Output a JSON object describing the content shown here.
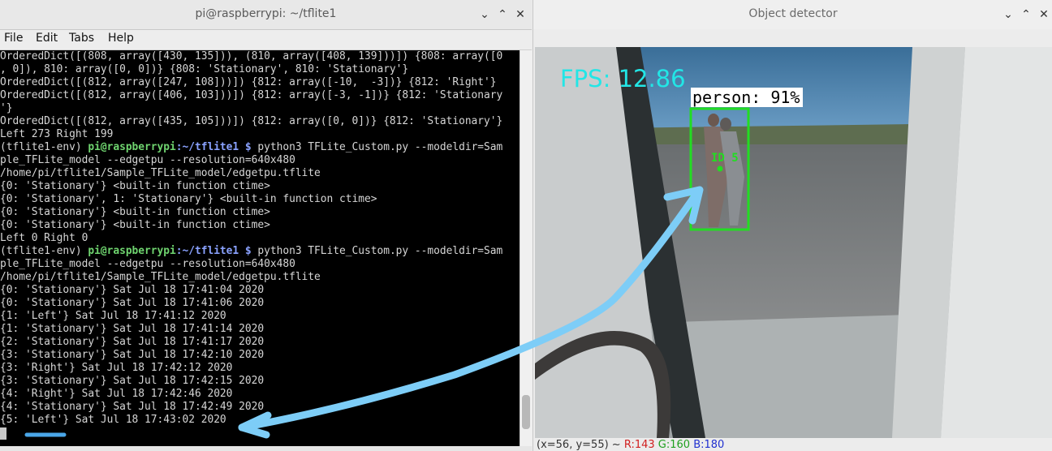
{
  "terminal": {
    "title": "pi@raspberrypi: ~/tflite1",
    "menu": [
      "File",
      "Edit",
      "Tabs",
      "Help"
    ],
    "lines": [
      {
        "text": "OrderedDict([(808, array([430, 135])), (810, array([408, 139]))]) {808: array([0"
      },
      {
        "text": ", 0]), 810: array([0, 0])} {808: 'Stationary', 810: 'Stationary'}"
      },
      {
        "text": "OrderedDict([(812, array([247, 108]))]) {812: array([-10,  -3])} {812: 'Right'}"
      },
      {
        "text": "OrderedDict([(812, array([406, 103]))]) {812: array([-3, -1])} {812: 'Stationary"
      },
      {
        "text": "'}"
      },
      {
        "text": "OrderedDict([(812, array([435, 105]))]) {812: array([0, 0])} {812: 'Stationary'}"
      },
      {
        "text": "Left 273 Right 199"
      },
      {
        "env": "(tflite1-env) ",
        "user": "pi@raspberrypi",
        "path": ":~/tflite1 $",
        "cmd": " python3 TFLite_Custom.py --modeldir=Sam"
      },
      {
        "text": "ple_TFLite_model --edgetpu --resolution=640x480"
      },
      {
        "text": "/home/pi/tflite1/Sample_TFLite_model/edgetpu.tflite"
      },
      {
        "text": "{0: 'Stationary'} <built-in function ctime>"
      },
      {
        "text": "{0: 'Stationary', 1: 'Stationary'} <built-in function ctime>"
      },
      {
        "text": "{0: 'Stationary'} <built-in function ctime>"
      },
      {
        "text": "{0: 'Stationary'} <built-in function ctime>"
      },
      {
        "text": "Left 0 Right 0"
      },
      {
        "env": "(tflite1-env) ",
        "user": "pi@raspberrypi",
        "path": ":~/tflite1 $",
        "cmd": " python3 TFLite_Custom.py --modeldir=Sam"
      },
      {
        "text": "ple_TFLite_model --edgetpu --resolution=640x480"
      },
      {
        "text": "/home/pi/tflite1/Sample_TFLite_model/edgetpu.tflite"
      },
      {
        "text": "{0: 'Stationary'} Sat Jul 18 17:41:04 2020"
      },
      {
        "text": "{0: 'Stationary'} Sat Jul 18 17:41:06 2020"
      },
      {
        "text": "{1: 'Left'} Sat Jul 18 17:41:12 2020"
      },
      {
        "text": "{1: 'Stationary'} Sat Jul 18 17:41:14 2020"
      },
      {
        "text": "{2: 'Stationary'} Sat Jul 18 17:41:17 2020"
      },
      {
        "text": "{3: 'Stationary'} Sat Jul 18 17:42:10 2020"
      },
      {
        "text": "{3: 'Right'} Sat Jul 18 17:42:12 2020"
      },
      {
        "text": "{3: 'Stationary'} Sat Jul 18 17:42:15 2020"
      },
      {
        "text": "{4: 'Right'} Sat Jul 18 17:42:46 2020"
      },
      {
        "text": "{4: 'Stationary'} Sat Jul 18 17:42:49 2020"
      },
      {
        "text": "{5: 'Left'} Sat Jul 18 17:43:02 2020"
      }
    ],
    "buttons": {
      "minimize": "⌄",
      "maximize": "⌃",
      "close": "✕"
    }
  },
  "detector": {
    "title": "Object detector",
    "fps_label": "FPS: 12.86",
    "detection_label": "person: 91%",
    "track_id_label": "ID 5",
    "status": {
      "coords": "(x=56, y=55) ~ ",
      "r": "R:143",
      "g": "G:160",
      "b": "B:180"
    },
    "buttons": {
      "minimize": "⌄",
      "maximize": "⌃",
      "close": "✕"
    }
  },
  "annotation_color": "#7dcdf7",
  "box_color": "#22dd22",
  "fps_color": "#22e6e6"
}
